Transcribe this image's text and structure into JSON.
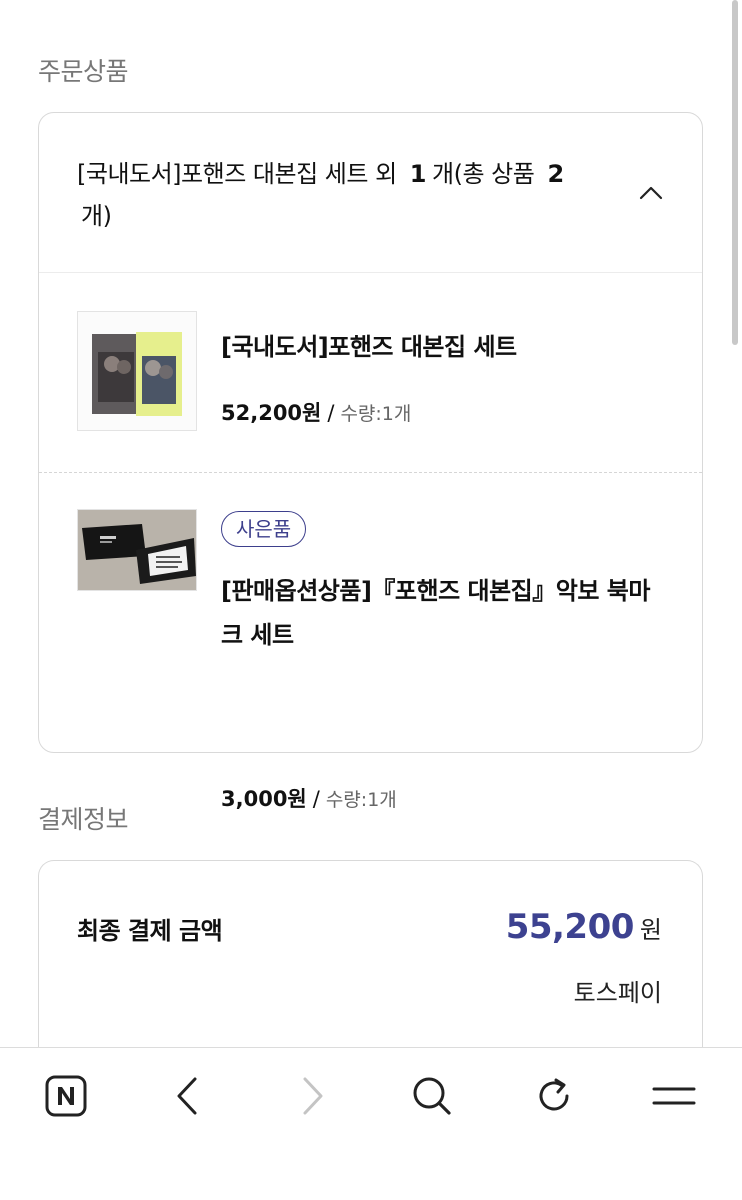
{
  "order_section": {
    "title": "주문상품",
    "summary_prefix": "[국내도서]포핸즈 대본집 세트 외",
    "summary_extra_count": "1",
    "summary_mid": "개(총 상품",
    "summary_total_count": "2",
    "summary_suffix": "개)"
  },
  "items": [
    {
      "name": "[국내도서]포핸즈 대본집 세트",
      "price": "52,200원",
      "separator": "/",
      "quantity": "수량:1개"
    },
    {
      "badge": "사은품",
      "name": "[판매옵션상품]『포핸즈 대본집』악보 북마크 세트",
      "price": "3,000원",
      "separator": "/",
      "quantity": "수량:1개"
    }
  ],
  "payment_section": {
    "title": "결제정보",
    "final_label": "최종 결제 금액",
    "final_amount": "55,200",
    "currency": "원",
    "method": "토스페이"
  },
  "bottom_nav": {
    "icons": [
      "naver-home-icon",
      "back-icon",
      "forward-icon",
      "search-icon",
      "refresh-icon",
      "menu-icon"
    ]
  },
  "colors": {
    "accent": "#3d4290",
    "badge": "#3d3f8c",
    "section_title": "#777777"
  }
}
